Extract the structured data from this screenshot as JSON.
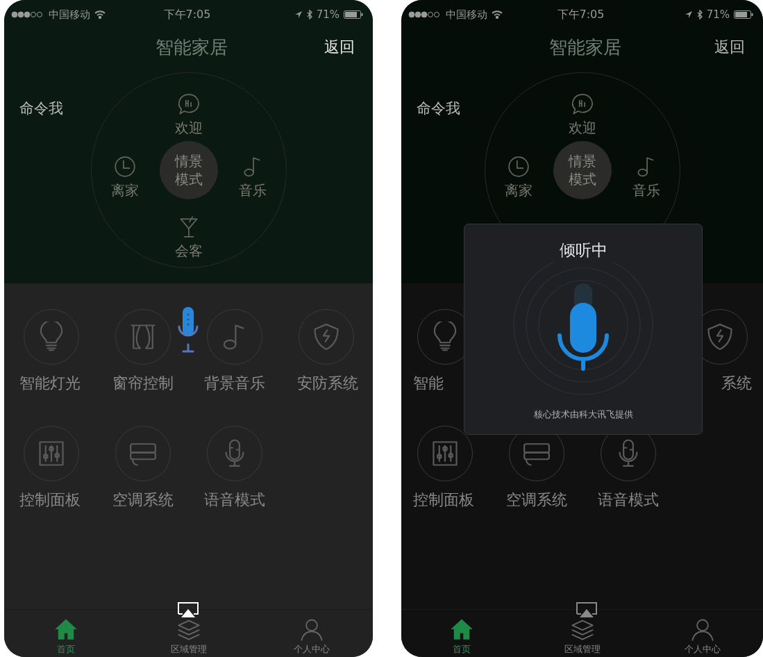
{
  "screens": [
    {
      "status_bar": {
        "carrier": "中国移动",
        "time": "下午7:05",
        "battery": "71%"
      },
      "header": {
        "title": "智能家居",
        "back": "返回"
      },
      "prompt": "命令我",
      "scene_wheel": {
        "center": "情景模式",
        "items": [
          {
            "kind": "hi",
            "label": "欢迎"
          },
          {
            "kind": "clock",
            "label": "离家"
          },
          {
            "kind": "note",
            "label": "音乐"
          },
          {
            "kind": "cocktail",
            "label": "会客"
          }
        ]
      },
      "features": [
        {
          "kind": "bulb",
          "label": "智能灯光"
        },
        {
          "kind": "curtain",
          "label": "窗帘控制"
        },
        {
          "kind": "note",
          "label": "背景音乐"
        },
        {
          "kind": "shield",
          "label": "安防系统"
        },
        {
          "kind": "sliders",
          "label": "控制面板"
        },
        {
          "kind": "aircon",
          "label": "空调系统"
        },
        {
          "kind": "mic",
          "label": "语音模式"
        }
      ],
      "tabs": [
        {
          "kind": "home",
          "label": "首页",
          "selected": true
        },
        {
          "kind": "layers",
          "label": "区域管理",
          "selected": false
        },
        {
          "kind": "person",
          "label": "个人中心",
          "selected": false
        }
      ]
    },
    {
      "status_bar": {
        "carrier": "中国移动",
        "time": "下午7:05",
        "battery": "71%"
      },
      "header": {
        "title": "智能家居",
        "back": "返回"
      },
      "prompt": "命令我",
      "scene_wheel": {
        "center": "情景模式",
        "items": [
          {
            "kind": "hi",
            "label": "欢迎"
          },
          {
            "kind": "clock",
            "label": "离家"
          },
          {
            "kind": "note",
            "label": "音乐"
          }
        ]
      },
      "features": [
        {
          "kind": "bulb",
          "label": "智能"
        },
        {
          "kind": "covered"
        },
        {
          "kind": "covered"
        },
        {
          "kind": "shield",
          "label": "系统"
        },
        {
          "kind": "sliders",
          "label": "控制面板"
        },
        {
          "kind": "aircon",
          "label": "空调系统"
        },
        {
          "kind": "mic",
          "label": "语音模式"
        }
      ],
      "tabs": [
        {
          "kind": "home",
          "label": "首页",
          "selected": true
        },
        {
          "kind": "layers",
          "label": "区域管理",
          "selected": false
        },
        {
          "kind": "person",
          "label": "个人中心",
          "selected": false
        }
      ],
      "dialog": {
        "title": "倾听中",
        "footer": "核心技术由科大讯飞提供"
      }
    }
  ]
}
